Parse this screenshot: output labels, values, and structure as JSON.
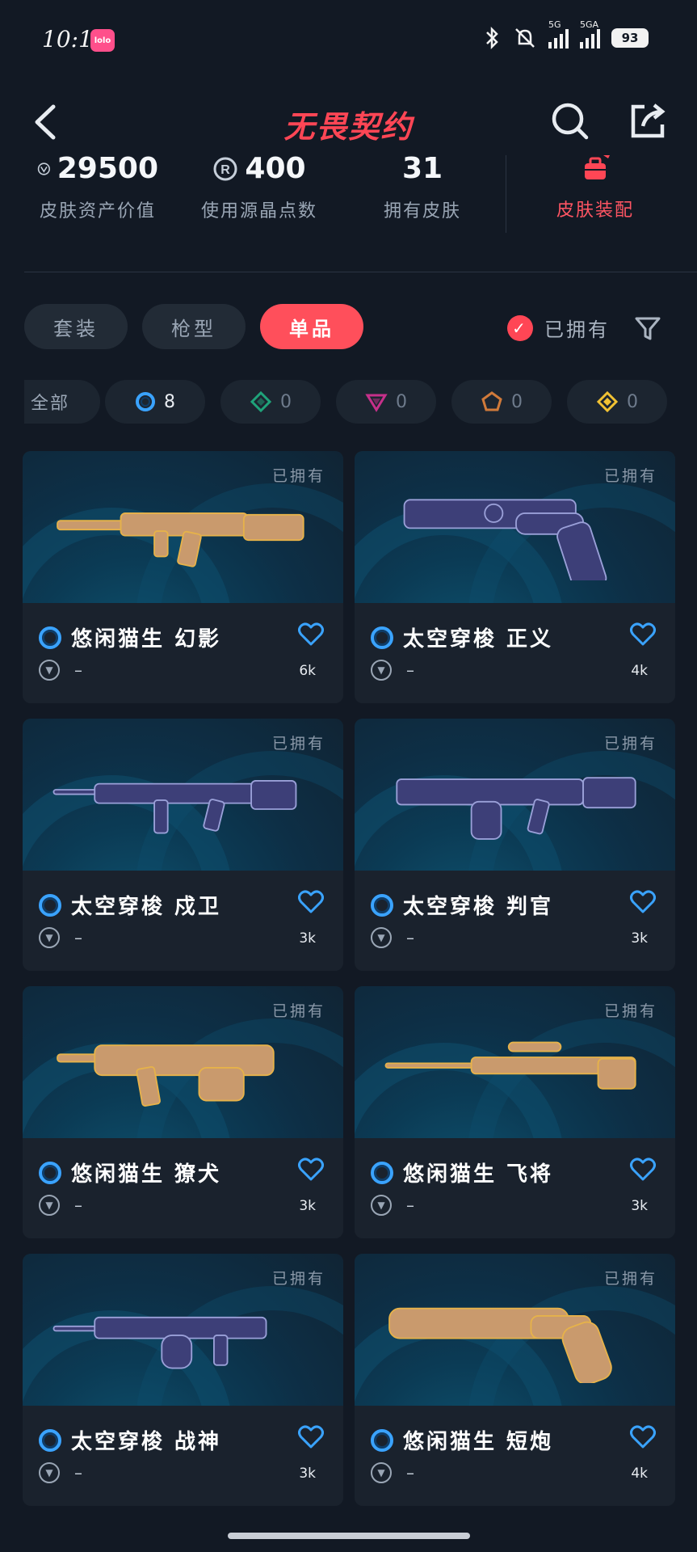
{
  "status_bar": {
    "time": "10:13",
    "app_badge": "lolo",
    "network_1": "5G",
    "network_2": "5GA",
    "battery": "93"
  },
  "header": {
    "title": "无畏契约"
  },
  "stats": [
    {
      "value": "29500",
      "label": "皮肤资产价值",
      "icon": "vp-currency-icon"
    },
    {
      "value": "400",
      "label": "使用源晶点数",
      "icon": "radianite-icon"
    },
    {
      "value": "31",
      "label": "拥有皮肤",
      "icon": ""
    },
    {
      "value": "",
      "label": "皮肤装配",
      "icon": "loadout-icon",
      "accent": "#ff5563"
    }
  ],
  "tabs": [
    {
      "label": "套装",
      "active": false
    },
    {
      "label": "枪型",
      "active": false
    },
    {
      "label": "单品",
      "active": true
    }
  ],
  "owned_filter": {
    "label": "已拥有",
    "checked": true
  },
  "rarity_chips": [
    {
      "label": "全部",
      "count": ""
    },
    {
      "icon": "select-tier-icon",
      "count": "8",
      "color": "#3aa3ff"
    },
    {
      "icon": "deluxe-tier-icon",
      "count": "0",
      "color": "#1fa37a"
    },
    {
      "icon": "premium-tier-icon",
      "count": "0",
      "color": "#c6308a"
    },
    {
      "icon": "exclusive-tier-icon",
      "count": "0",
      "color": "#d07a3a"
    },
    {
      "icon": "ultra-tier-icon",
      "count": "0",
      "color": "#f1c233"
    }
  ],
  "owned_tag": "已拥有",
  "skins": [
    {
      "name": "悠闲猫生 幻影",
      "price": "–",
      "favorites": "6k",
      "theme": "cat"
    },
    {
      "name": "太空穿梭 正义",
      "price": "–",
      "favorites": "4k",
      "theme": "space"
    },
    {
      "name": "太空穿梭 戍卫",
      "price": "–",
      "favorites": "3k",
      "theme": "space"
    },
    {
      "name": "太空穿梭 判官",
      "price": "–",
      "favorites": "3k",
      "theme": "space"
    },
    {
      "name": "悠闲猫生 獠犬",
      "price": "–",
      "favorites": "3k",
      "theme": "cat"
    },
    {
      "name": "悠闲猫生 飞将",
      "price": "–",
      "favorites": "3k",
      "theme": "cat"
    },
    {
      "name": "太空穿梭 战神",
      "price": "–",
      "favorites": "3k",
      "theme": "space"
    },
    {
      "name": "悠闲猫生 短炮",
      "price": "–",
      "favorites": "4k",
      "theme": "cat"
    }
  ],
  "colors": {
    "accent": "#ff4655",
    "background": "#121924",
    "card": "#1a222d",
    "select_tier": "#3aa3ff",
    "favorite": "#3aa3ff"
  }
}
